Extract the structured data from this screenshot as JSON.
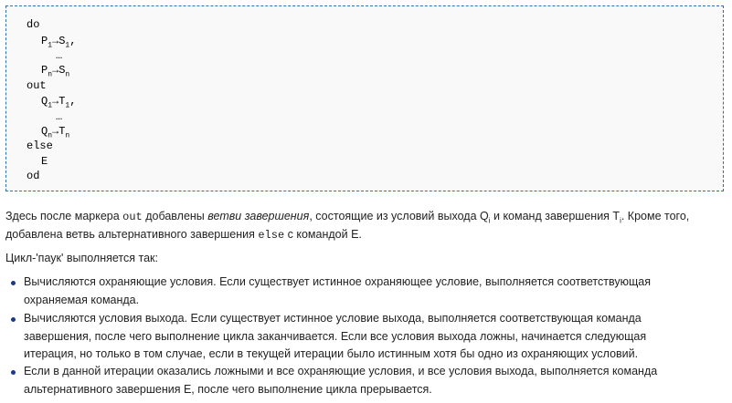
{
  "code_block": {
    "do_kw": "do",
    "p1_a": "P",
    "p1_a_sub": "1",
    "p1_arrow": "→",
    "p1_b": "S",
    "p1_b_sub": "1",
    "p1_tail": ",",
    "ellipsis1": "…",
    "pn_a": "P",
    "pn_a_sub": "n",
    "pn_arrow": "→",
    "pn_b": "S",
    "pn_b_sub": "n",
    "out_kw": "out",
    "q1_a": "Q",
    "q1_a_sub": "1",
    "q1_arrow": "→",
    "q1_b": "T",
    "q1_b_sub": "1",
    "q1_tail": ",",
    "ellipsis2": "…",
    "qn_a": "Q",
    "qn_a_sub": "n",
    "qn_arrow": "→",
    "qn_b": "T",
    "qn_b_sub": "n",
    "else_kw": "else",
    "e_line": "E",
    "od_kw": "od"
  },
  "paragraph1": {
    "t1": "Здесь после маркера ",
    "code_out": "out",
    "t2": " добавлены ",
    "em": "ветви завершения",
    "t3": ", состоящие из условий выхода Q",
    "sub_i": "i",
    "t4": " и команд завершения T",
    "sub_i2": "i",
    "t5": ". Кроме того,",
    "line2_t1": "добавлена ветвь альтернативного завершения ",
    "code_else": "else",
    "line2_t2": " с командой E."
  },
  "paragraph2": "Цикл-'паук' выполняется так:",
  "bullets": [
    {
      "line1": "Вычисляются охраняющие условия. Если существует истинное охраняющее условие, выполняется соответствующая",
      "line2": "охраняемая команда."
    },
    {
      "line1": "Вычисляются условия выхода. Если существует истинное условие выхода, выполняется соответствующая команда",
      "line2": "завершения, после чего выполнение цикла заканчивается. Если все условия выхода ложны, начинается следующая",
      "line3": "итерация, но только в том случае, если в текущей итерации было истинным хотя бы одно из охраняющих условий."
    },
    {
      "line1": "Если в данной итерации оказались ложными и все охраняющие условия, и все условия выхода, выполняется команда",
      "line2": "альтернативного завершения E, после чего выполнение цикла прерывается."
    }
  ]
}
